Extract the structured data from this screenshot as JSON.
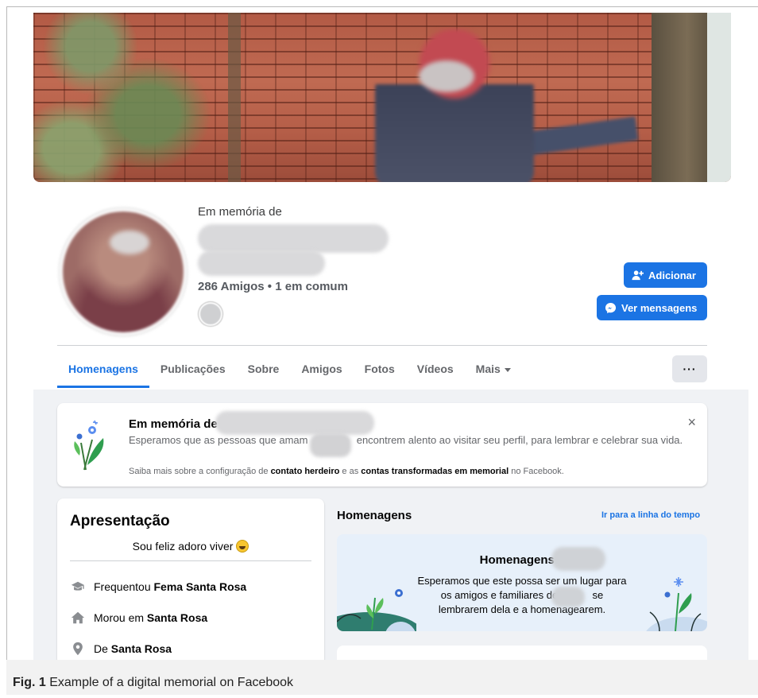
{
  "profile": {
    "memorial_label": "Em memória de",
    "friends_text": "286 Amigos • 1 em comum",
    "add_button": "Adicionar",
    "messages_button": "Ver mensagens"
  },
  "tabs": [
    {
      "label": "Homenagens",
      "active": true
    },
    {
      "label": "Publicações"
    },
    {
      "label": "Sobre"
    },
    {
      "label": "Amigos"
    },
    {
      "label": "Fotos"
    },
    {
      "label": "Vídeos"
    },
    {
      "label": "Mais"
    }
  ],
  "more_menu_label": "···",
  "banner": {
    "title": "Em memória de",
    "text_part1": "Esperamos que as pessoas que amam",
    "text_part2": "encontrem alento ao visitar seu perfil, para lembrar e celebrar sua vida.",
    "note_prefix": "Saiba mais sobre a configuração de",
    "note_link1": "contato herdeiro",
    "note_mid": "e as",
    "note_link2": "contas transformadas em memorial",
    "note_suffix": "no Facebook.",
    "close_icon": "×"
  },
  "intro": {
    "title": "Apresentação",
    "bio": "Sou feliz adoro viver",
    "rows": [
      {
        "icon": "graduation-cap-icon",
        "prefix": "Frequentou",
        "value": "Fema Santa Rosa"
      },
      {
        "icon": "home-icon",
        "prefix": "Morou em",
        "value": "Santa Rosa"
      },
      {
        "icon": "location-pin-icon",
        "prefix": "De",
        "value": "Santa Rosa"
      }
    ]
  },
  "tributes": {
    "heading": "Homenagens",
    "timeline_link": "Ir para a linha do tempo",
    "card_title": "Homenagens a",
    "card_text_part1": "Esperamos que este possa ser um lugar para os amigos e familiares de",
    "card_text_part2": "se lembrarem dela e a homenagearem."
  },
  "caption": {
    "label": "Fig. 1",
    "text": "Example of a digital memorial on Facebook"
  },
  "colors": {
    "accent": "#1b74e4",
    "page_bg": "#f0f2f5"
  }
}
